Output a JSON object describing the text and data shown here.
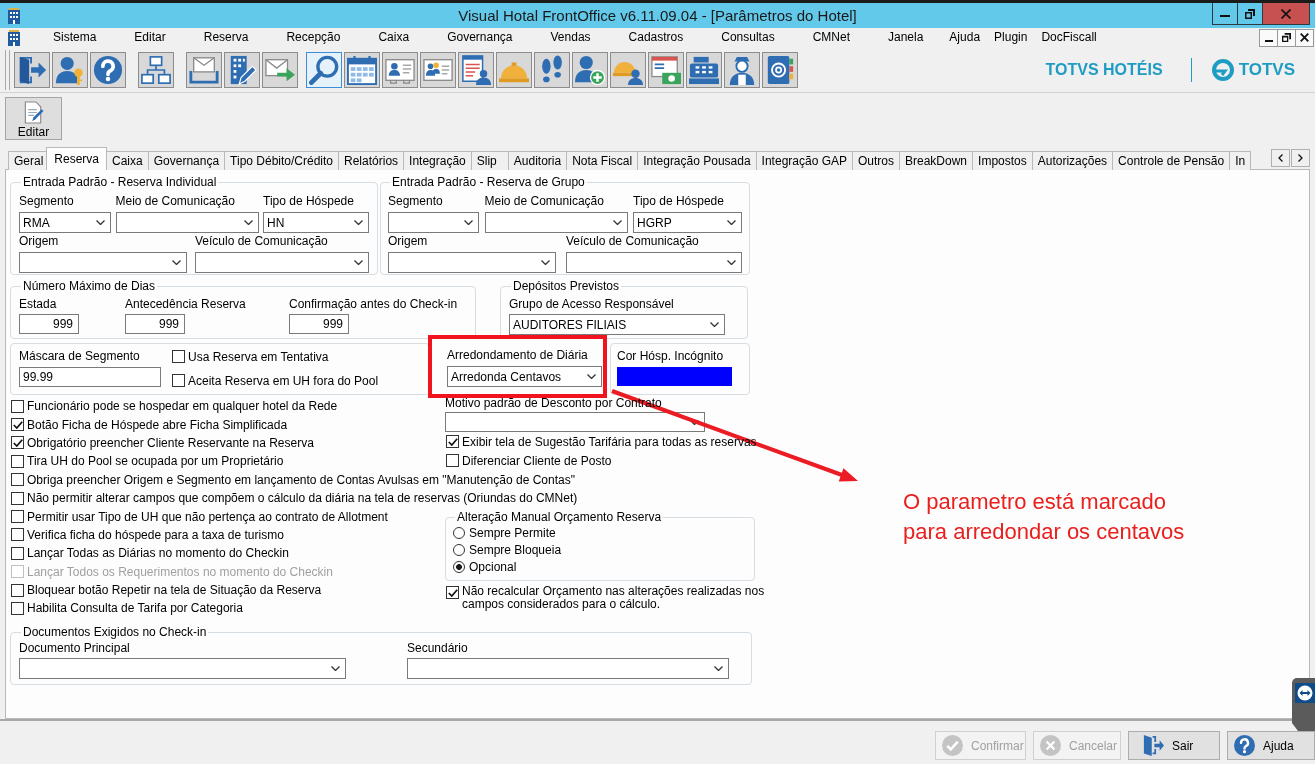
{
  "window": {
    "title": "Visual Hotal FrontOffice v6.11.09.04 - [Parâmetros do Hotel]"
  },
  "menu": [
    "Sistema",
    "Editar",
    "Reserva",
    "Recepção",
    "Caixa",
    "Governança",
    "Vendas",
    "Cadastros",
    "Consultas",
    "CMNet",
    "Janela",
    "Ajuda",
    "Plugin",
    "DocFiscall"
  ],
  "toolbar": [
    {
      "selected": false
    },
    {
      "selected": false
    },
    {
      "selected": false
    },
    {
      "selected": false
    },
    {
      "selected": false
    },
    {
      "selected": false
    },
    {
      "selected": false
    },
    {
      "selected": true
    },
    {
      "selected": false
    },
    {
      "selected": false
    },
    {
      "selected": false
    },
    {
      "selected": false
    },
    {
      "selected": false
    },
    {
      "selected": false
    },
    {
      "selected": false
    },
    {
      "selected": false
    },
    {
      "selected": false
    },
    {
      "selected": false
    },
    {
      "selected": false
    },
    {
      "selected": false
    }
  ],
  "brand": {
    "product": "TOTVS HOTÉIS",
    "company": "TOTVS"
  },
  "edit_button": {
    "label": "Editar"
  },
  "tabs": [
    {
      "label": "Geral",
      "selected": false
    },
    {
      "label": "Reserva",
      "selected": true
    },
    {
      "label": "Caixa",
      "selected": false
    },
    {
      "label": "Governança",
      "selected": false
    },
    {
      "label": "Tipo Débito/Crédito",
      "selected": false
    },
    {
      "label": "Relatórios",
      "selected": false
    },
    {
      "label": "Integração",
      "selected": false
    },
    {
      "label": "Slip",
      "selected": false
    },
    {
      "label": "Auditoria",
      "selected": false
    },
    {
      "label": "Nota Fiscal",
      "selected": false
    },
    {
      "label": "Integração Pousada",
      "selected": false
    },
    {
      "label": "Integração GAP",
      "selected": false
    },
    {
      "label": "Outros",
      "selected": false
    },
    {
      "label": "BreakDown",
      "selected": false
    },
    {
      "label": "Impostos",
      "selected": false
    },
    {
      "label": "Autorizações",
      "selected": false
    },
    {
      "label": "Controle de Pensão",
      "selected": false
    },
    {
      "label": "In",
      "selected": false
    }
  ],
  "individual_entry": {
    "title": "Entrada Padrão - Reserva Individual",
    "fields": [
      {
        "label": "Segmento",
        "value": "RMA"
      },
      {
        "label": "Meio de Comunicação"
      },
      {
        "label": "Tipo de Hóspede",
        "value": "HN"
      },
      {
        "label": "Origem"
      },
      {
        "label": "Veículo de Comunicação"
      }
    ]
  },
  "group_entry": {
    "title": "Entrada Padrão - Reserva de Grupo",
    "fields": [
      {
        "label": "Segmento"
      },
      {
        "label": "Meio de Comunicação"
      },
      {
        "label": "Tipo de Hóspede",
        "value": "HGRP"
      },
      {
        "label": "Origem"
      },
      {
        "label": "Veículo de Comunicação"
      }
    ]
  },
  "max_days": {
    "title": "Número Máximo de Dias",
    "fields": [
      {
        "label": "Estada",
        "value": "999"
      },
      {
        "label": "Antecedência Reserva",
        "value": "999"
      },
      {
        "label": "Confirmação antes do Check-in",
        "value": "999"
      }
    ]
  },
  "deposits": {
    "title": "Depósitos Previstos",
    "field": {
      "label": "Grupo de Acesso Responsável",
      "value": "AUDITORES FILIAIS"
    }
  },
  "segment_mask": {
    "label": "Máscara de Segmento",
    "value": "99.99",
    "options": [
      {
        "label": "Usa Reserva em Tentativa",
        "checked": false
      },
      {
        "label": "Aceita Reserva em UH fora do Pool",
        "checked": false
      }
    ]
  },
  "rounding": {
    "label": "Arredondamento de Diária",
    "value": "Arredonda Centavos"
  },
  "incognito_color": {
    "label": "Cor Hósp. Incógnito",
    "color": "#0000ff"
  },
  "options": [
    {
      "label": "Funcionário pode se hospedar em qualquer hotel da Rede",
      "checked": false,
      "disabled": false
    },
    {
      "label": "Botão Ficha de Hóspede abre Ficha Simplificada",
      "checked": true,
      "disabled": false
    },
    {
      "label": "Obrigatório preencher Cliente Reservante na Reserva",
      "checked": true,
      "disabled": false
    },
    {
      "label": "Tira UH do Pool se ocupada por um Proprietário",
      "checked": false,
      "disabled": false
    },
    {
      "label": "Obriga preencher Origem e Segmento em lançamento de Contas Avulsas em \"Manutenção de Contas\"",
      "checked": false,
      "disabled": false
    },
    {
      "label": "Não permitir alterar campos que compõem o cálculo da diária na tela de reservas (Oriundas do CMNet)",
      "checked": false,
      "disabled": false
    },
    {
      "label": "Permitir usar Tipo de UH que não pertença ao contrato de Allotment",
      "checked": false,
      "disabled": false
    },
    {
      "label": "Verifica ficha do hóspede para a taxa de turismo",
      "checked": false,
      "disabled": false
    },
    {
      "label": "Lançar Todas as Diárias no momento do Checkin",
      "checked": false,
      "disabled": false
    },
    {
      "label": "Lançar Todos os Requerimentos no momento do Checkin",
      "checked": false,
      "disabled": true
    },
    {
      "label": "Bloquear botão Repetir na tela de Situação da Reserva",
      "checked": false,
      "disabled": false
    },
    {
      "label": "Habilita Consulta de Tarifa por Categoria",
      "checked": false,
      "disabled": false
    }
  ],
  "discount_reason": {
    "label": "Motivo padrão de Desconto por Contrato"
  },
  "right_options": [
    {
      "label": "Exibir tela de Sugestão Tarifária para todas as reservas",
      "checked": true
    },
    {
      "label": "Diferenciar Cliente de Posto",
      "checked": false
    }
  ],
  "budget_change": {
    "title": "Alteração Manual Orçamento Reserva",
    "choices": [
      {
        "label": "Sempre Permite",
        "selected": false
      },
      {
        "label": "Sempre Bloqueia",
        "selected": false
      },
      {
        "label": "Opcional",
        "selected": true
      }
    ]
  },
  "recalc_option": {
    "label": "Não recalcular Orçamento nas alterações realizadas nos campos considerados para o cálculo.",
    "checked": true
  },
  "documents": {
    "title": "Documentos Exigidos no Check-in",
    "fields": [
      {
        "label": "Documento Principal"
      },
      {
        "label": "Secundário"
      }
    ]
  },
  "footer_buttons": [
    {
      "label": "Confirmar",
      "disabled": true
    },
    {
      "label": "Cancelar",
      "disabled": true
    },
    {
      "label": "Sair",
      "disabled": false
    },
    {
      "label": "Ajuda",
      "disabled": false
    }
  ],
  "annotation": {
    "text": "O parametro está marcado\npara arredondar os centavos"
  }
}
